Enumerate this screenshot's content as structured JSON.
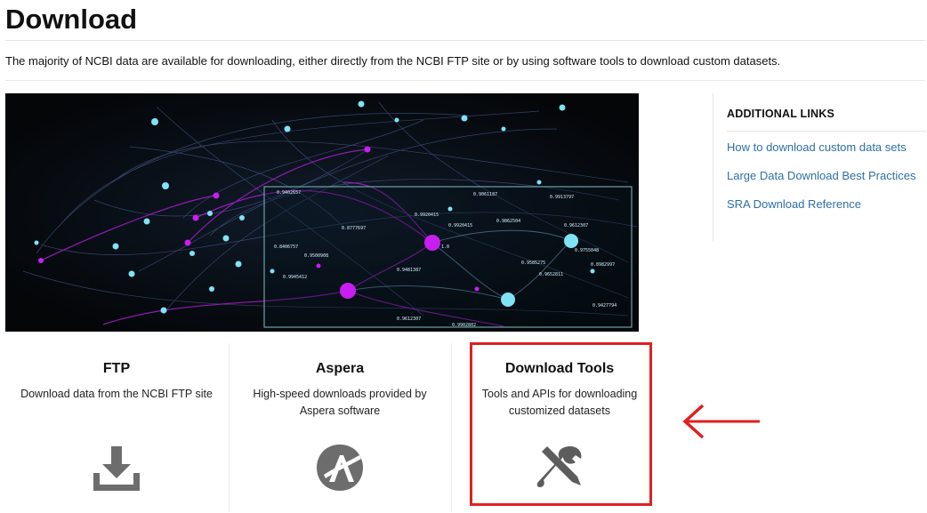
{
  "page": {
    "title": "Download",
    "intro": "The majority of NCBI data are available for downloading, either directly from the NCBI FTP site or by using software tools to download custom datasets."
  },
  "hero": {
    "node_labels": [
      "0.9402657",
      "0.8777697",
      "0.9061187",
      "0.9913797",
      "0.9920415",
      "0.9862504",
      "0.9612307",
      "0.9755048",
      "0.9585275",
      "0.9500908",
      "0.9945412",
      "0.8406757",
      "0.8982997",
      "0.9481387",
      "0.9652811",
      "0.9427794",
      "0.9920415",
      "0.9902802",
      "0.9612307",
      "1.0"
    ]
  },
  "sidebar": {
    "heading": "ADDITIONAL LINKS",
    "links": [
      {
        "label": "How to download custom data sets"
      },
      {
        "label": "Large Data Download Best Practices"
      },
      {
        "label": "SRA Download Reference"
      }
    ]
  },
  "cards": [
    {
      "title": "FTP",
      "description": "Download data from the NCBI FTP site",
      "icon": "download-icon"
    },
    {
      "title": "Aspera",
      "description": "High-speed downloads provided by Aspera software",
      "icon": "aspera-logo-icon"
    },
    {
      "title": "Download Tools",
      "description": "Tools and APIs for downloading customized datasets",
      "icon": "tools-icon"
    }
  ],
  "colors": {
    "link": "#2e6fa6",
    "highlight": "#e02020",
    "icon_gray": "#6d6d6d",
    "node_cyan": "#7fe3f5",
    "node_magenta": "#c81ef0"
  }
}
